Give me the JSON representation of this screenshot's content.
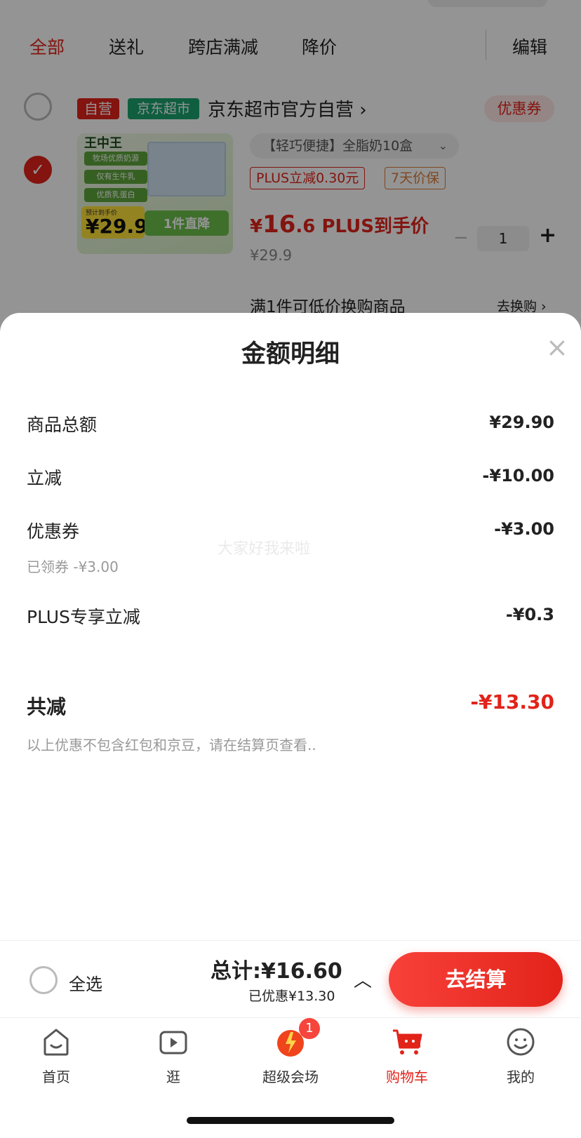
{
  "filters": {
    "tabs": [
      "全部",
      "送礼",
      "跨店满减",
      "降价"
    ],
    "edit_label": "编辑"
  },
  "shop": {
    "self_tag": "自营",
    "market_tag": "京东超市",
    "name": "京东超市官方自营 ›",
    "coupon_label": "优惠券"
  },
  "product": {
    "image": {
      "brand": "王中王",
      "features": [
        "牧场优质奶源",
        "仅有生牛乳",
        "优质乳蛋白"
      ],
      "badge_label": "预计到手价",
      "badge_price": "¥29.9",
      "band_text": "1件直降"
    },
    "variant": "【轻巧便捷】全脂奶10盒",
    "tags": [
      "PLUS立减0.30元",
      "7天价保"
    ],
    "plus_price_yen": "¥",
    "plus_price_big": "16",
    "plus_price_rest": ".6 PLUS到手价",
    "orig_price": "¥29.9",
    "qty_minus": "−",
    "quantity": "1",
    "qty_plus": "+",
    "gift_text": "满1件可低价换购商品",
    "gift_link": "去换购 ›"
  },
  "sheet": {
    "title": "金额明细",
    "close": "×",
    "rows": [
      {
        "label": "商品总额",
        "value": "¥29.90"
      },
      {
        "label": "立减",
        "value": "-¥10.00"
      },
      {
        "label": "优惠券",
        "value": "-¥3.00",
        "sub": "已领券 -¥3.00"
      },
      {
        "label": "PLUS专享立减",
        "value": "-¥0.3"
      }
    ],
    "total_label": "共减",
    "total_value": "-¥13.30",
    "note": "以上优惠不包含红包和京豆，请在结算页查看..",
    "watermark": "大家好我来啦"
  },
  "checkout": {
    "select_all": "全选",
    "sum": "总计:¥16.60",
    "saved": "已优惠¥13.30",
    "caret": "︿",
    "pay_button": "去结算"
  },
  "tabbar": {
    "tabs": [
      {
        "label": "首页",
        "icon": "home-icon"
      },
      {
        "label": "逛",
        "icon": "video-icon"
      },
      {
        "label": "超级会场",
        "icon": "super-venue-icon",
        "badge": "1"
      },
      {
        "label": "购物车",
        "icon": "cart-icon",
        "active": true
      },
      {
        "label": "我的",
        "icon": "profile-icon"
      }
    ]
  },
  "colors": {
    "accent": "#e2231a",
    "market_green": "#1aa36f"
  }
}
